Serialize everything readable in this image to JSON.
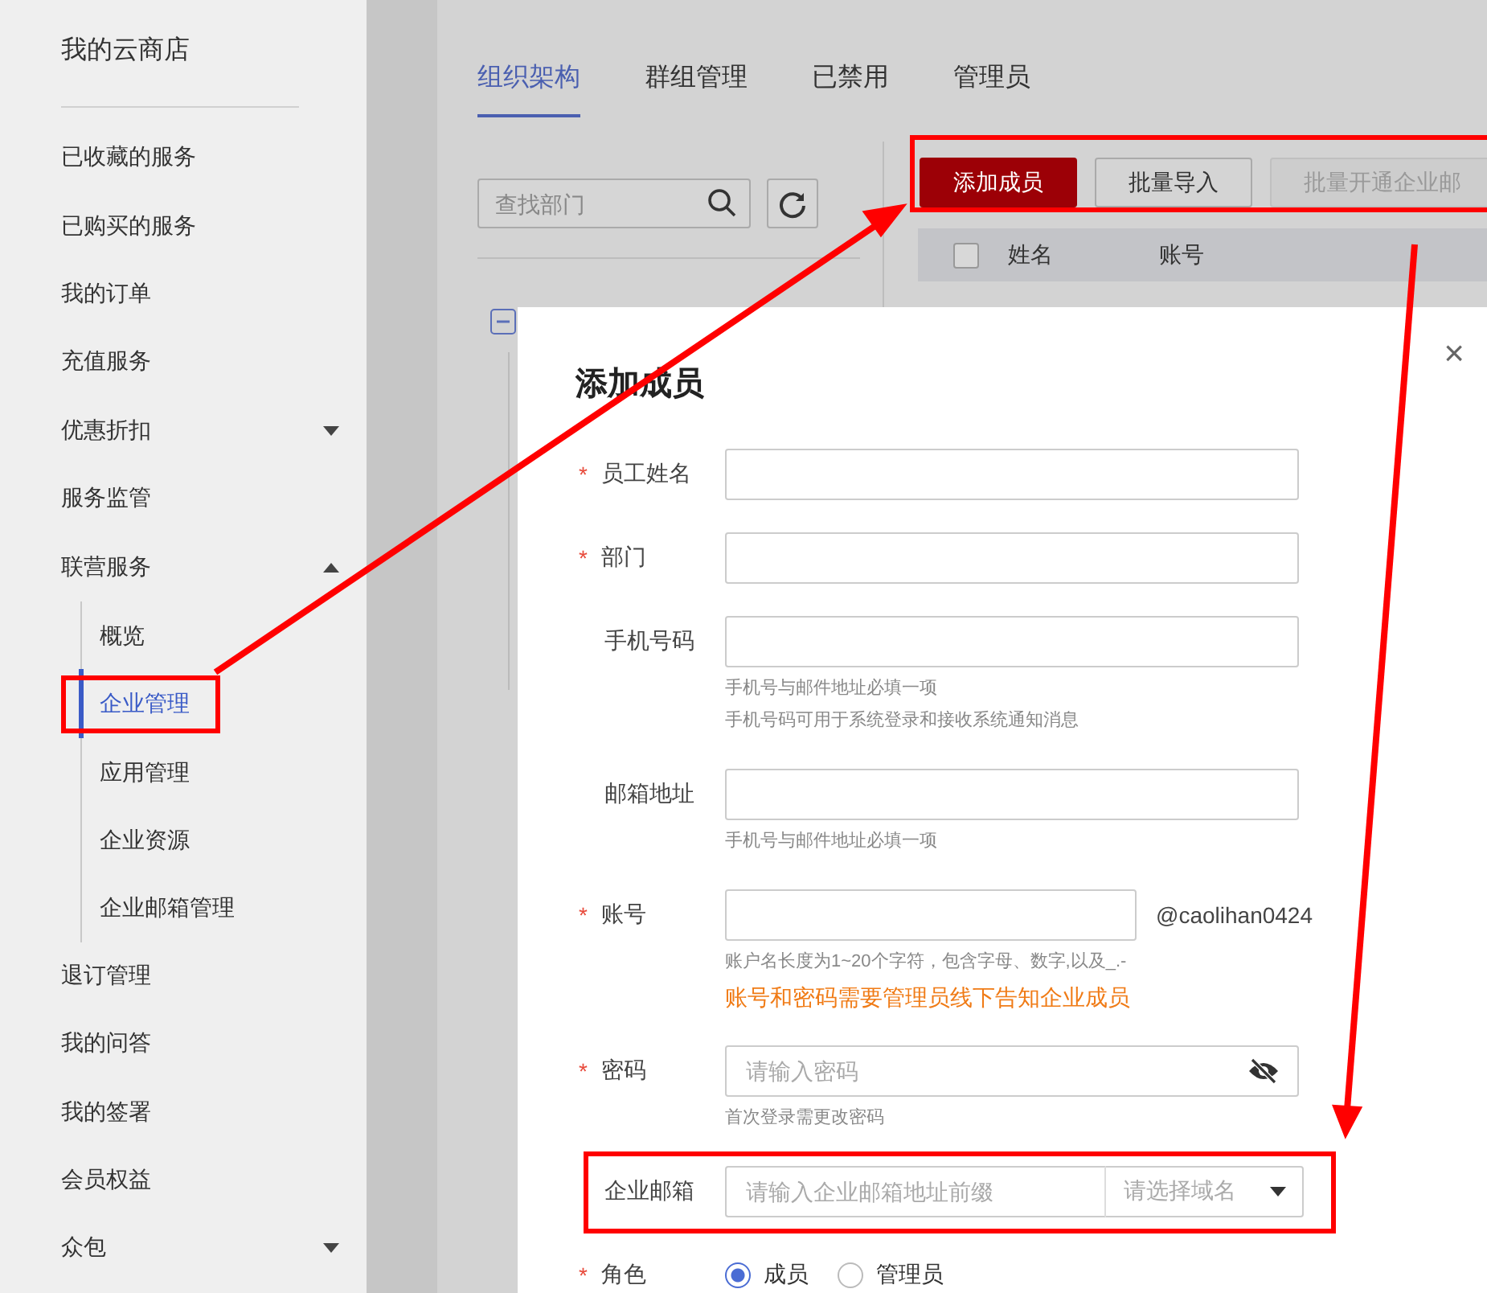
{
  "sidebar": {
    "title": "我的云商店",
    "items": [
      {
        "kind": "link",
        "label": "已收藏的服务",
        "selected": false
      },
      {
        "kind": "link",
        "label": "已购买的服务",
        "selected": false
      },
      {
        "kind": "link",
        "label": "我的订单",
        "selected": false
      },
      {
        "kind": "link",
        "label": "充值服务",
        "selected": false
      },
      {
        "kind": "group",
        "label": "优惠折扣",
        "selected": false,
        "expanded": false
      },
      {
        "kind": "link",
        "label": "服务监管",
        "selected": false
      },
      {
        "kind": "group",
        "label": "联营服务",
        "selected": false,
        "expanded": true,
        "children": [
          {
            "label": "概览",
            "selected": false
          },
          {
            "label": "企业管理",
            "selected": true
          },
          {
            "label": "应用管理",
            "selected": false
          },
          {
            "label": "企业资源",
            "selected": false
          },
          {
            "label": "企业邮箱管理",
            "selected": false
          }
        ]
      },
      {
        "kind": "link",
        "label": "退订管理",
        "selected": false
      },
      {
        "kind": "link",
        "label": "我的问答",
        "selected": false
      },
      {
        "kind": "link",
        "label": "我的签署",
        "selected": false
      },
      {
        "kind": "link",
        "label": "会员权益",
        "selected": false
      },
      {
        "kind": "group",
        "label": "众包",
        "selected": false,
        "expanded": false
      }
    ]
  },
  "tabs": [
    {
      "label": "组织架构",
      "selected": true
    },
    {
      "label": "群组管理",
      "selected": false
    },
    {
      "label": "已禁用",
      "selected": false
    },
    {
      "label": "管理员",
      "selected": false
    }
  ],
  "department_panel": {
    "search": {
      "placeholder": "查找部门"
    }
  },
  "member_panel": {
    "buttons": [
      {
        "label": "添加成员",
        "kind": "primary",
        "disabled": false
      },
      {
        "label": "批量导入",
        "kind": "default",
        "disabled": false
      },
      {
        "label": "批量开通企业邮",
        "kind": "default",
        "disabled": true
      }
    ],
    "table": {
      "columns": [
        "姓名",
        "账号"
      ],
      "select_all_checked": false
    }
  },
  "dialog": {
    "title": "添加成员",
    "close": "×",
    "required_mark": "*",
    "fields": [
      {
        "kind": "text",
        "label": "员工姓名",
        "required": true
      },
      {
        "kind": "text",
        "label": "部门",
        "required": true
      },
      {
        "kind": "text",
        "label": "手机号码",
        "required": false,
        "hints": [
          "手机号与邮件地址必填一项",
          "手机号码可用于系统登录和接收系统通知消息"
        ]
      },
      {
        "kind": "text",
        "label": "邮箱地址",
        "required": false,
        "hints": [
          "手机号与邮件地址必填一项"
        ]
      },
      {
        "kind": "account",
        "label": "账号",
        "required": true,
        "suffix": "@caolihan0424",
        "hints": [
          "账户名长度为1~20个字符，包含字母、数字,以及_.-"
        ],
        "notice": "账号和密码需要管理员线下告知企业成员"
      },
      {
        "kind": "password",
        "label": "密码",
        "required": true,
        "placeholder": "请输入密码",
        "hints": [
          "首次登录需更改密码"
        ]
      },
      {
        "kind": "email",
        "label": "企业邮箱",
        "required": false,
        "placeholder": "请输入企业邮箱地址前缀",
        "select_placeholder": "请选择域名"
      },
      {
        "kind": "radio",
        "label": "角色",
        "required": true,
        "options": [
          {
            "label": "成员",
            "selected": true
          },
          {
            "label": "管理员",
            "selected": false
          }
        ]
      }
    ]
  }
}
